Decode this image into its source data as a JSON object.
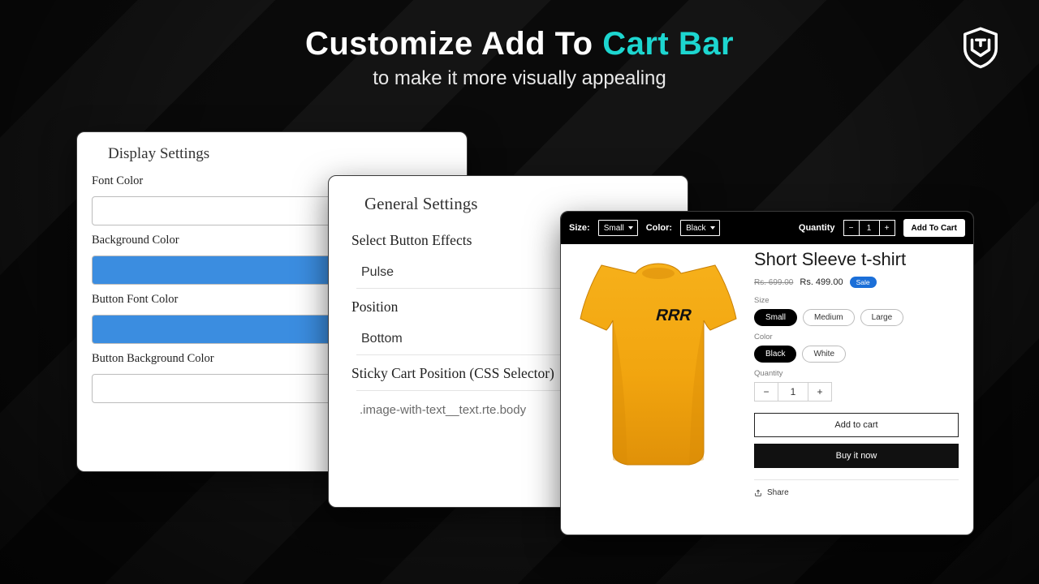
{
  "headline": {
    "part1": "Customize Add To ",
    "part2": "Cart Bar",
    "sub": "to make it more visually appealing"
  },
  "display": {
    "title": "Display Settings",
    "labels": {
      "font_color": "Font Color",
      "background_color": "Background Color",
      "button_font_color": "Button Font Color",
      "button_bg_color": "Button Background Color"
    },
    "swatches": {
      "font_color": "#ffffff",
      "background_color": "#3b8de0",
      "button_font_color": "#3b8de0",
      "button_bg_color": "#ffffff"
    }
  },
  "general": {
    "title": "General Settings",
    "labels": {
      "effects": "Select Button Effects",
      "position": "Position",
      "css": "Sticky Cart Position (CSS Selector)"
    },
    "values": {
      "effects": "Pulse",
      "position": "Bottom",
      "css": ".image-with-text__text.rte.body"
    }
  },
  "product": {
    "bar": {
      "size_label": "Size:",
      "size_value": "Small",
      "color_label": "Color:",
      "color_value": "Black",
      "qty_label": "Quantity",
      "qty_value": "1",
      "minus": "−",
      "plus": "+",
      "add_btn": "Add To Cart"
    },
    "title": "Short Sleeve t-shirt",
    "old_price": "Rs. 699.00",
    "new_price": "Rs. 499.00",
    "sale_badge": "Sale",
    "size_label": "Size",
    "sizes": [
      "Small",
      "Medium",
      "Large"
    ],
    "color_label": "Color",
    "colors": [
      "Black",
      "White"
    ],
    "qty_label": "Quantity",
    "qty_value": "1",
    "add_to_cart": "Add to cart",
    "buy_now": "Buy it now",
    "share": "Share",
    "tshirt_text": "RRR"
  }
}
